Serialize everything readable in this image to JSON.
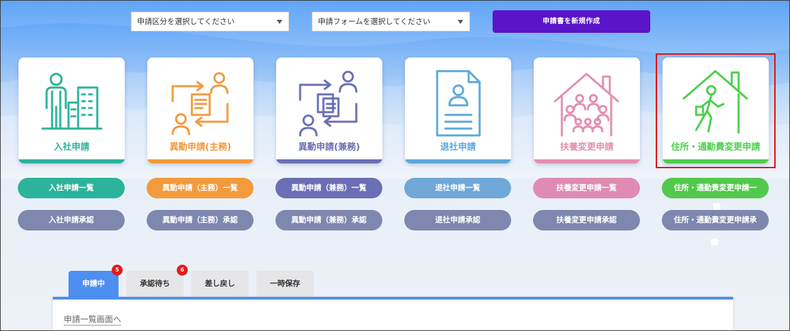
{
  "toolbar": {
    "category_select": "申請区分を選択してください",
    "form_select": "申請フォームを選択してください",
    "new_button": "申請書を新規作成"
  },
  "cards": [
    {
      "label": "入社申請",
      "color": "#2bb39b",
      "icon": "employee-building-icon"
    },
    {
      "label": "異動申請(主務)",
      "color": "#f39a3c",
      "icon": "transfer-main-icon"
    },
    {
      "label": "異動申請(兼務)",
      "color": "#6a6fb5",
      "icon": "transfer-concurrent-icon"
    },
    {
      "label": "退社申請",
      "color": "#5ba9da",
      "icon": "resignation-document-icon"
    },
    {
      "label": "扶養変更申請",
      "color": "#e28fb0",
      "icon": "family-house-icon"
    },
    {
      "label": "住所・通勤費変更申請",
      "color": "#4ccf4c",
      "icon": "commuter-house-icon"
    }
  ],
  "list_buttons": [
    {
      "label": "入社申請一覧",
      "color": "#2bb39b"
    },
    {
      "label": "異動申請（主務）一覧",
      "color": "#f39a3c"
    },
    {
      "label": "異動申請（兼務）一覧",
      "color": "#6a6fb5"
    },
    {
      "label": "退社申請一覧",
      "color": "#6fa8d8"
    },
    {
      "label": "扶養変更申請一覧",
      "color": "#e08bb3"
    },
    {
      "label": "住所・通勤費変更申請一",
      "color": "#52c94c"
    }
  ],
  "approve_buttons": [
    {
      "label": "入社申請承認"
    },
    {
      "label": "異動申請（主務）承認"
    },
    {
      "label": "異動申請（兼務）承認"
    },
    {
      "label": "退社申請承認"
    },
    {
      "label": "扶養変更申請承認"
    },
    {
      "label": "住所・通勤費変更申請承"
    }
  ],
  "approve_color": "#7e88ae",
  "tabs": [
    {
      "label": "申請中",
      "badge": "5",
      "active": true
    },
    {
      "label": "承認待ち",
      "badge": "6",
      "active": false
    },
    {
      "label": "差し戻し",
      "active": false
    },
    {
      "label": "一時保存",
      "active": false
    }
  ],
  "panel": {
    "link": "申請一覧画面へ"
  }
}
